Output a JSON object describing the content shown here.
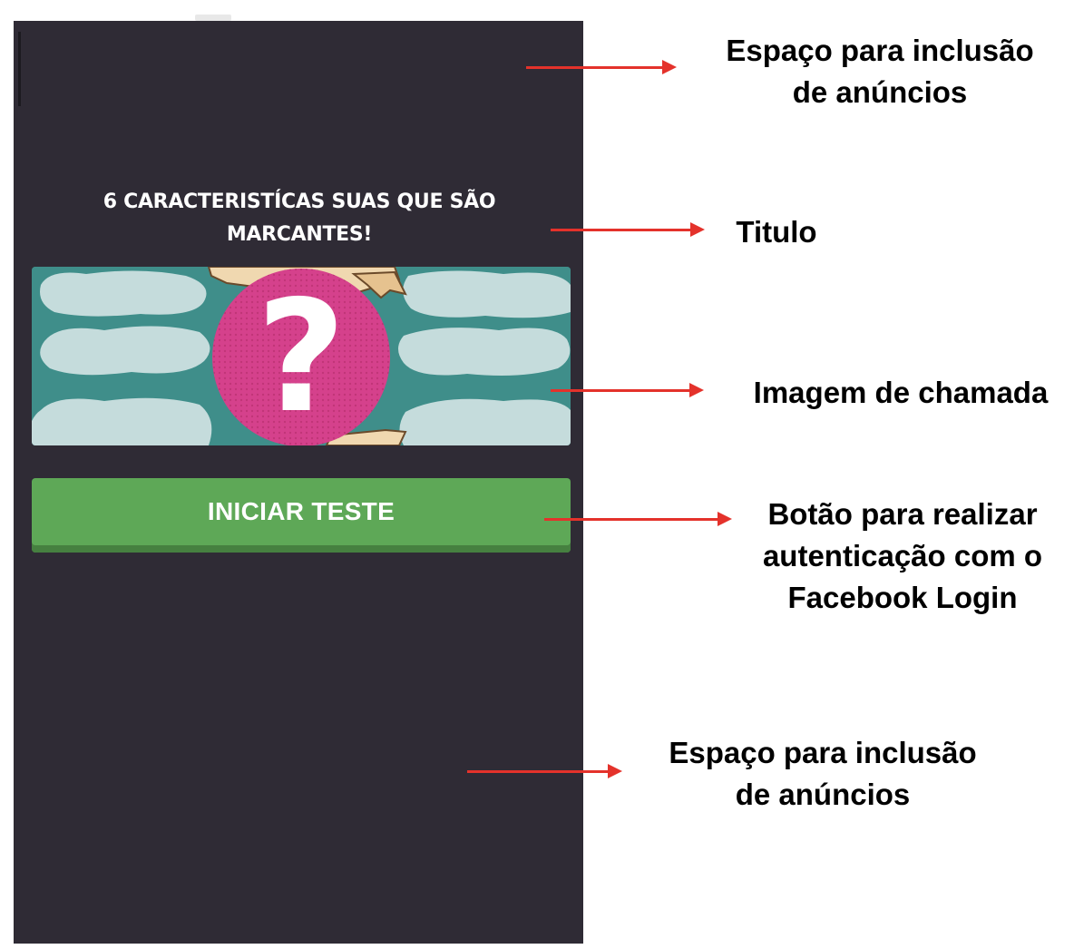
{
  "app": {
    "title": "6 CARACTERISTÍCAS SUAS QUE SÃO MARCANTES!",
    "title_line1": "6 CARACTERISTÍCAS SUAS QUE SÃO",
    "title_line2": "MARCANTES!",
    "start_button_label": "INICIAR TESTE",
    "hero_image": {
      "icon": "question-mark-icon",
      "question_glyph": "?"
    },
    "colors": {
      "screen_background": "#2f2b35",
      "button_green": "#5ea857",
      "hero_teal": "#3f8e8a",
      "hero_pink_circle": "#d5418c"
    }
  },
  "annotations": {
    "ad_space_top": {
      "line1": "Espaço para inclusão",
      "line2": "de anúncios"
    },
    "title_note": {
      "line1": "Titulo"
    },
    "image_note": {
      "line1": "Imagem de chamada"
    },
    "button_note": {
      "line1": "Botão para realizar",
      "line2": "autenticação com o",
      "line3": "Facebook Login"
    },
    "ad_space_bottom": {
      "line1": "Espaço para inclusão",
      "line2": "de anúncios"
    },
    "arrow_color": "#e4322b"
  }
}
